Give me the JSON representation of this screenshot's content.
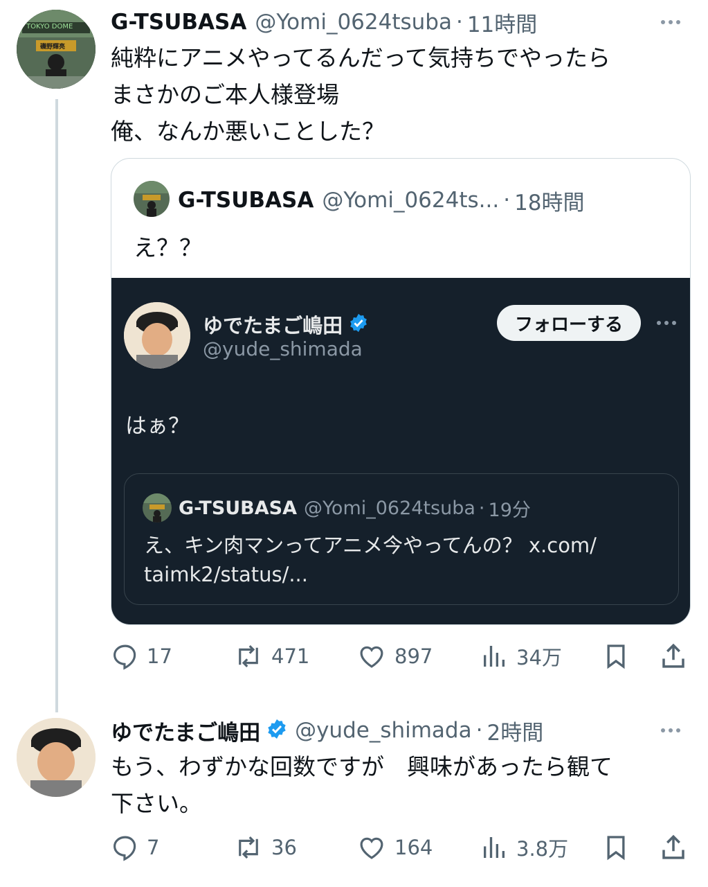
{
  "tweet1": {
    "name": "G-TSUBASA",
    "handle": "@Yomi_0624tsuba",
    "time": "11時間",
    "lines": [
      "純粋にアニメやってるんだって気持ちでやったら",
      "まさかのご本人様登場",
      "俺、なんか悪いことした？"
    ],
    "avatar_sign": "TOKYO DOME",
    "avatar_banner": "磯野輝亮",
    "quote": {
      "name": "G-TSUBASA",
      "handle": "@Yomi_0624ts...",
      "time": "18時間",
      "text": "え？？",
      "screenshot": {
        "name": "ゆでたまご嶋田",
        "handle": "@yude_shimada",
        "follow_label": "フォローする",
        "text": "はぁ？",
        "inner": {
          "name": "G-TSUBASA",
          "handle": "@Yomi_0624tsuba",
          "time": "19分",
          "lines": [
            "え、キン肉マンってアニメ今やってんの？ x.com/",
            "taimk2/status/..."
          ]
        }
      }
    },
    "actions": {
      "reply": "17",
      "retweet": "471",
      "like": "897",
      "views": "34万"
    }
  },
  "tweet2": {
    "name": "ゆでたまご嶋田",
    "handle": "@yude_shimada",
    "time": "2時間",
    "lines": [
      "もう、わずかな回数ですが　興味があったら観て",
      "下さい。"
    ],
    "actions": {
      "reply": "7",
      "retweet": "36",
      "like": "164",
      "views": "3.8万"
    }
  },
  "colors": {
    "verified": "#1d9bf0",
    "muted": "#536471",
    "dark_bg": "#15202b",
    "border": "#cfd9de"
  }
}
